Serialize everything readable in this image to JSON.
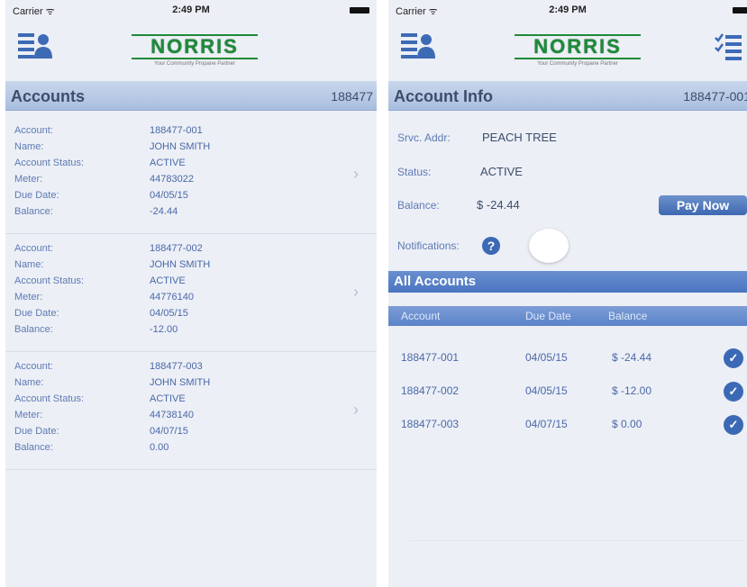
{
  "status_bar": {
    "carrier": "Carrier ᯤ",
    "time": "2:49 PM"
  },
  "logo": {
    "word": "NORRIS",
    "tagline": "Your Community Propane Partner"
  },
  "accounts_screen": {
    "title": "Accounts",
    "number": "188477",
    "labels": {
      "account": "Account:",
      "name": "Name:",
      "status": "Account Status:",
      "meter": "Meter:",
      "due": "Due Date:",
      "balance": "Balance:"
    },
    "items": [
      {
        "account": "188477-001",
        "name": "JOHN SMITH",
        "status": "ACTIVE",
        "meter": "44783022",
        "due": "04/05/15",
        "balance": "-24.44"
      },
      {
        "account": "188477-002",
        "name": "JOHN SMITH",
        "status": "ACTIVE",
        "meter": "44776140",
        "due": "04/05/15",
        "balance": "-12.00"
      },
      {
        "account": "188477-003",
        "name": "JOHN SMITH",
        "status": "ACTIVE",
        "meter": "44738140",
        "due": "04/07/15",
        "balance": "0.00"
      }
    ]
  },
  "info_screen": {
    "title": "Account Info",
    "number": "188477-001",
    "srvc_label": "Srvc. Addr:",
    "srvc_value": "PEACH TREE",
    "status_label": "Status:",
    "status_value": "ACTIVE",
    "balance_label": "Balance:",
    "balance_value": "$ -24.44",
    "pay_now": "Pay Now",
    "notifications_label": "Notifications:",
    "help": "?",
    "all_accounts": "All Accounts",
    "columns": [
      "Account",
      "Due Date",
      "Balance"
    ],
    "rows": [
      {
        "account": "188477-001",
        "due": "04/05/15",
        "balance": "$ -24.44"
      },
      {
        "account": "188477-002",
        "due": "04/05/15",
        "balance": "$ -12.00"
      },
      {
        "account": "188477-003",
        "due": "04/07/15",
        "balance": "$ 0.00"
      }
    ]
  },
  "colors": {
    "accent": "#3c69b5",
    "header_gradient": "#a8bedf",
    "brand_green": "#1f8a3a"
  }
}
